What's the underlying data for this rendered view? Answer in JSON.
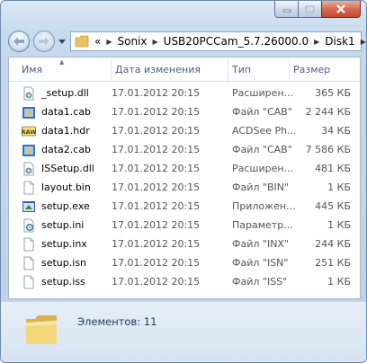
{
  "nav": {
    "path": [
      "Sonix",
      "USB20PCCam_5.7.26000.0",
      "Disk1"
    ],
    "overflow": "«"
  },
  "columns": {
    "name": "Имя",
    "date": "Дата изменения",
    "type": "Тип",
    "size": "Размер"
  },
  "files": [
    {
      "name": "_setup.dll",
      "date": "17.01.2012 20:15",
      "type": "Расширен...",
      "size": "365 КБ",
      "icon": "dll-icon"
    },
    {
      "name": "data1.cab",
      "date": "17.01.2012 20:15",
      "type": "Файл \"CAB\"",
      "size": "2 244 КБ",
      "icon": "cab-icon"
    },
    {
      "name": "data1.hdr",
      "date": "17.01.2012 20:15",
      "type": "ACDSee Ph...",
      "size": "34 КБ",
      "icon": "raw-icon"
    },
    {
      "name": "data2.cab",
      "date": "17.01.2012 20:15",
      "type": "Файл \"CAB\"",
      "size": "7 586 КБ",
      "icon": "cab-icon"
    },
    {
      "name": "ISSetup.dll",
      "date": "17.01.2012 20:15",
      "type": "Расширен...",
      "size": "481 КБ",
      "icon": "dll-icon"
    },
    {
      "name": "layout.bin",
      "date": "17.01.2012 20:15",
      "type": "Файл \"BIN\"",
      "size": "1 КБ",
      "icon": "file-icon"
    },
    {
      "name": "setup.exe",
      "date": "17.01.2012 20:15",
      "type": "Приложен...",
      "size": "445 КБ",
      "icon": "exe-icon"
    },
    {
      "name": "setup.ini",
      "date": "17.01.2012 20:15",
      "type": "Параметр...",
      "size": "1 КБ",
      "icon": "ini-icon"
    },
    {
      "name": "setup.inx",
      "date": "17.01.2012 20:15",
      "type": "Файл \"INX\"",
      "size": "244 КБ",
      "icon": "file-icon"
    },
    {
      "name": "setup.isn",
      "date": "17.01.2012 20:15",
      "type": "Файл \"ISN\"",
      "size": "251 КБ",
      "icon": "file-icon"
    },
    {
      "name": "setup.iss",
      "date": "17.01.2012 20:15",
      "type": "Файл \"ISS\"",
      "size": "1 КБ",
      "icon": "file-icon"
    }
  ],
  "status": {
    "count_text": "Элементов: 11"
  },
  "colors": {
    "frame": "#c6d9ee",
    "close": "#c44a2d",
    "header_text": "#4c607a"
  }
}
